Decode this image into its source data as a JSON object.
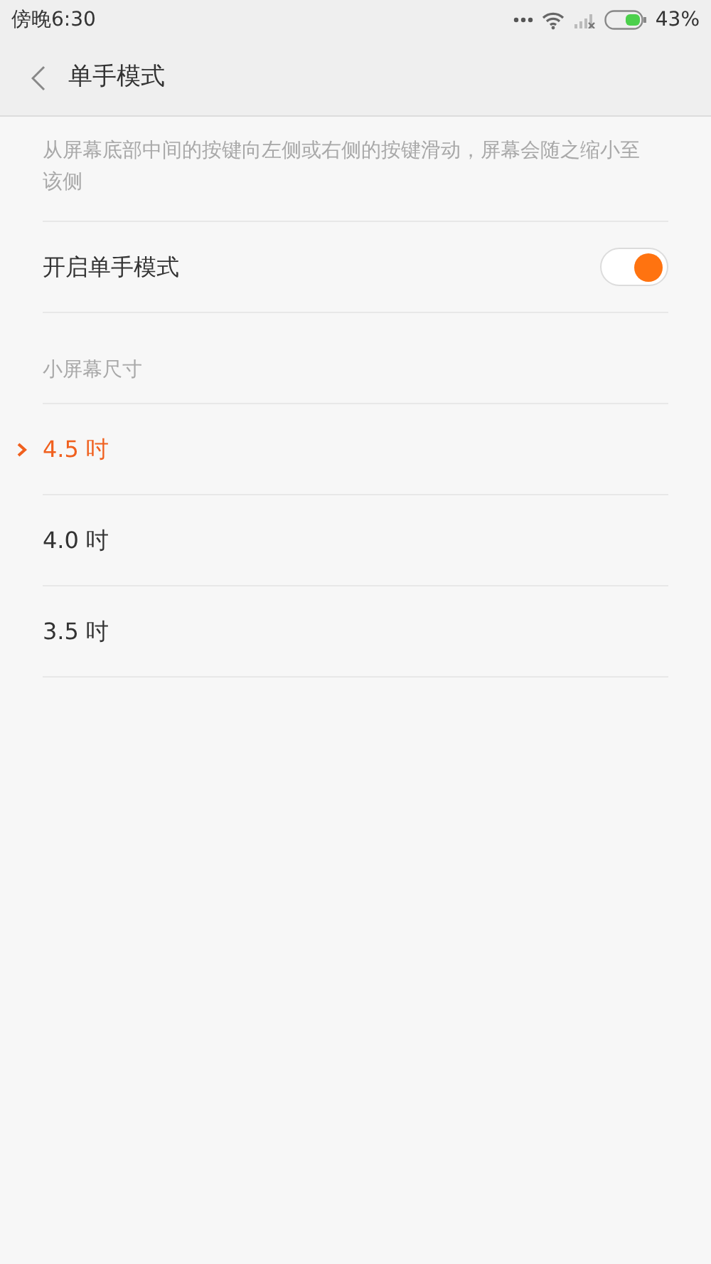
{
  "status_bar": {
    "time": "傍晚6:30",
    "battery": "43%"
  },
  "header": {
    "title": "单手模式"
  },
  "description": "从屏幕底部中间的按键向左侧或右侧的按键滑动，屏幕会随之缩小至该侧",
  "toggle": {
    "label": "开启单手模式",
    "on": true
  },
  "section": {
    "title": "小屏幕尺寸"
  },
  "sizes": [
    {
      "label": "4.5 吋",
      "selected": true
    },
    {
      "label": "4.0 吋",
      "selected": false
    },
    {
      "label": "3.5 吋",
      "selected": false
    }
  ]
}
